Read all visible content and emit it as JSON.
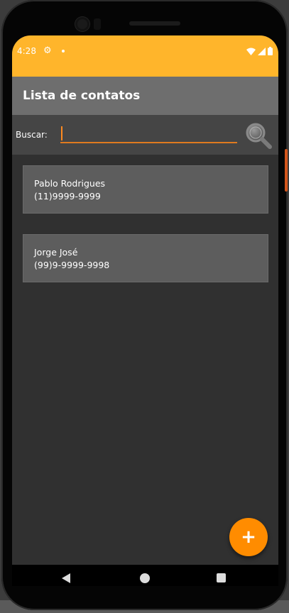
{
  "status_bar": {
    "time": "4:28",
    "color": "#ffb52b"
  },
  "app_bar": {
    "title": "Lista de contatos",
    "color": "#6e6e6e"
  },
  "search": {
    "label": "Buscar:",
    "value": "",
    "placeholder": "",
    "icon": "search-icon"
  },
  "contacts": [
    {
      "name": "Pablo Rodrigues",
      "phone": "(11)9999-9999"
    },
    {
      "name": "Jorge José",
      "phone": "(99)9-9999-9998"
    }
  ],
  "fab": {
    "label": "+",
    "color": "#ff8c00"
  },
  "navigation": {
    "icons": [
      "back-icon",
      "home-icon",
      "recents-icon"
    ]
  }
}
